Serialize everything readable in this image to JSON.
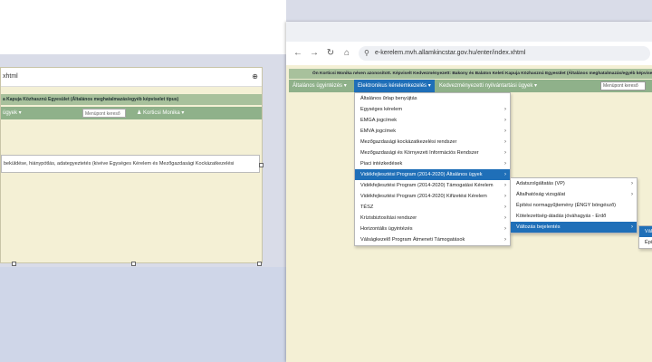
{
  "left_window": {
    "address_text": "xhtml",
    "title_bar": "a Kapuja Közhasznú Egyesület (Általános meghatalmazás/egyéb képviselet típus)",
    "menu_item": "ügyek",
    "search_placeholder": "Menüpont kereső",
    "user": "Korticsi Monika",
    "text_row": "beküldése, hiánypótlás, adategyeztetés (kivéve Egységes Kérelem és Mezőgazdasági Kockázatkezelési"
  },
  "browser": {
    "url": "e-kerelem.mvh.allamkincstar.gov.hu/enter/index.xhtml",
    "nav": {
      "back": "←",
      "forward": "→",
      "reload": "↻",
      "home": "⌂",
      "site_info": "⚲"
    }
  },
  "header": {
    "info": "Ön Korticsi Monika néven azonosított.  Képviselt Kedvezményezett: Bakony és Balaton Keleti Kapuja Közhasznú Egyesület (Általános meghatalmazás/egyéb képviselet típus)",
    "menus": [
      "Általános ügyintézés",
      "Elektronikus kérelemkezelés",
      "Kedvezményezetti nyilvántartási ügyek"
    ],
    "search_placeholder": "Menüpont kereső"
  },
  "menu1": [
    {
      "label": "Általános űrlap benyújtás",
      "sub": false
    },
    {
      "label": "Egységes kérelem",
      "sub": true
    },
    {
      "label": "EMGA jogcímek",
      "sub": true
    },
    {
      "label": "EMVA jogcímek",
      "sub": true
    },
    {
      "label": "Mezőgazdasági kockázatkezelési rendszer",
      "sub": true
    },
    {
      "label": "Mezőgazdasági és Környezeti Információs Rendszer",
      "sub": true
    },
    {
      "label": "Piaci intézkedések",
      "sub": true
    },
    {
      "label": "Vidékfejlesztési Program (2014-2020) Általános ügyek",
      "sub": true
    },
    {
      "label": "Vidékfejlesztési Program (2014-2020) Támogatási Kérelem",
      "sub": true
    },
    {
      "label": "Vidékfejlesztési Program (2014-2020) Kifizetési Kérelem",
      "sub": true
    },
    {
      "label": "TÉSZ",
      "sub": true
    },
    {
      "label": "Krízisbiztosítási rendszer",
      "sub": true
    },
    {
      "label": "Horizontális ügyintézés",
      "sub": true
    },
    {
      "label": "Válságkezelő Program Átmeneti Támogatások",
      "sub": true
    }
  ],
  "menu2": [
    {
      "label": "Adatszolgáltatás (VP)",
      "sub": true
    },
    {
      "label": "Általhatóság vizsgálat",
      "sub": true
    },
    {
      "label": "Építési normagyűjtemény (ÉNGY böngésző)",
      "sub": false
    },
    {
      "label": "Kötelezettség-átadás jóváhagyás - Erdő",
      "sub": false
    },
    {
      "label": "Változás bejelentés",
      "sub": true
    }
  ],
  "menu3": [
    {
      "label": "Vált"
    },
    {
      "label": "Épít"
    }
  ]
}
